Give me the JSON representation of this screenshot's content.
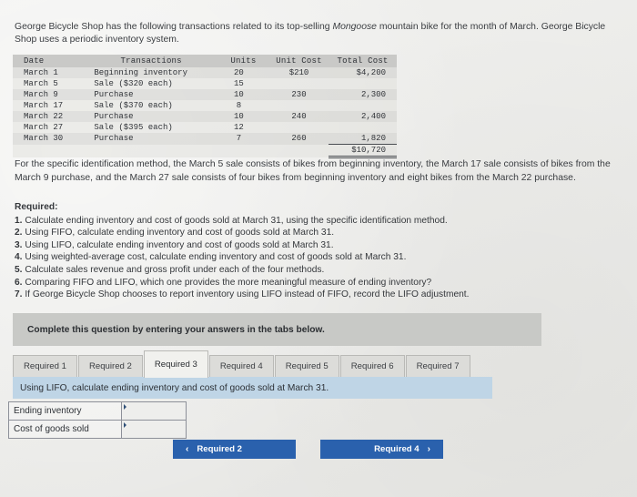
{
  "intro": {
    "line1_before": "George Bicycle Shop has the following transactions related to its top-selling ",
    "line1_em": "Mongoose",
    "line1_after": " mountain bike for the month of March. George Bicycle Shop uses a periodic inventory system."
  },
  "table": {
    "headers": [
      "Date",
      "Transactions",
      "Units",
      "Unit Cost",
      "Total Cost"
    ],
    "rows": [
      {
        "date": "March 1",
        "transaction": "Beginning inventory",
        "units": "20",
        "unit_cost": "$210",
        "total_cost": "$4,200"
      },
      {
        "date": "March 5",
        "transaction": "Sale ($320 each)",
        "units": "15",
        "unit_cost": "",
        "total_cost": ""
      },
      {
        "date": "March 9",
        "transaction": "Purchase",
        "units": "10",
        "unit_cost": "230",
        "total_cost": "2,300"
      },
      {
        "date": "March 17",
        "transaction": "Sale ($370 each)",
        "units": "8",
        "unit_cost": "",
        "total_cost": ""
      },
      {
        "date": "March 22",
        "transaction": "Purchase",
        "units": "10",
        "unit_cost": "240",
        "total_cost": "2,400"
      },
      {
        "date": "March 27",
        "transaction": "Sale ($395 each)",
        "units": "12",
        "unit_cost": "",
        "total_cost": ""
      },
      {
        "date": "March 30",
        "transaction": "Purchase",
        "units": "7",
        "unit_cost": "260",
        "total_cost": "1,820"
      }
    ],
    "grand_total": "$10,720"
  },
  "spec_para": "For the specific identification method, the March 5 sale consists of bikes from beginning inventory, the March 17 sale consists of bikes from the March 9 purchase, and the March 27 sale consists of four bikes from beginning inventory and eight bikes from the March 22 purchase.",
  "required": {
    "title": "Required:",
    "items": [
      {
        "num": "1.",
        "text": " Calculate ending inventory and cost of goods sold at March 31, using the specific identification method."
      },
      {
        "num": "2.",
        "text": " Using FIFO, calculate ending inventory and cost of goods sold at March 31."
      },
      {
        "num": "3.",
        "text": " Using LIFO, calculate ending inventory and cost of goods sold at March 31."
      },
      {
        "num": "4.",
        "text": " Using weighted-average cost, calculate ending inventory and cost of goods sold at March 31."
      },
      {
        "num": "5.",
        "text": " Calculate sales revenue and gross profit under each of the four methods."
      },
      {
        "num": "6.",
        "text": " Comparing FIFO and LIFO, which one provides the more meaningful measure of ending inventory?"
      },
      {
        "num": "7.",
        "text": " If George Bicycle Shop chooses to report inventory using LIFO instead of FIFO, record the LIFO adjustment."
      }
    ]
  },
  "answer_widget": {
    "banner": "Complete this question by entering your answers in the tabs below.",
    "tabs": [
      {
        "label": "Required 1",
        "active": false
      },
      {
        "label": "Required 2",
        "active": false
      },
      {
        "label": "Required 3",
        "active": true
      },
      {
        "label": "Required 4",
        "active": false
      },
      {
        "label": "Required 5",
        "active": false
      },
      {
        "label": "Required 6",
        "active": false
      },
      {
        "label": "Required 7",
        "active": false
      }
    ],
    "tab_prompt": "Using LIFO, calculate ending inventory and cost of goods sold at March 31.",
    "answer_rows": [
      {
        "label": "Ending inventory",
        "value": ""
      },
      {
        "label": "Cost of goods sold",
        "value": ""
      }
    ],
    "nav": {
      "prev_label": "Required 2",
      "prev_chevron": "‹",
      "next_label": "Required 4",
      "next_chevron": "›"
    }
  },
  "colors": {
    "page_bg": "#e9e9e6",
    "table_header_bg": "#c9c9c7",
    "banner_gray": "#c8c9c6",
    "tab_prompt_blue": "#bfd5e6",
    "button_blue": "#2a61ad",
    "active_tab_bg": "#f1f1ee"
  }
}
